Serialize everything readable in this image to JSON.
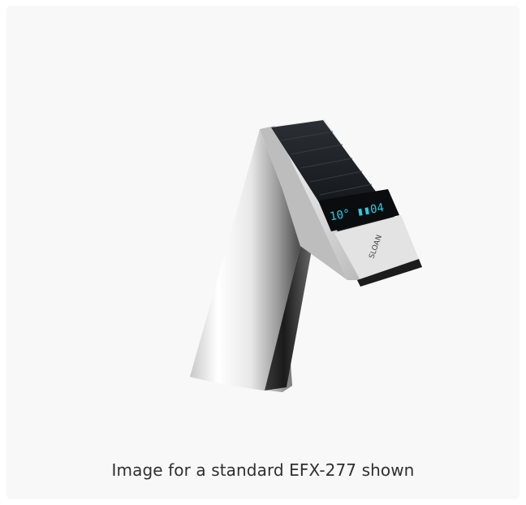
{
  "product": {
    "image_alt": "Sloan EFX-277 sensor faucet with solar panel and digital display",
    "brand_mark": "SLOAN",
    "display_readout": "10° 04",
    "caption": "Image for a standard EFX-277 shown"
  },
  "colors": {
    "background": "#f8f8f8",
    "display_glow": "#21d0e6",
    "caption_text": "#2f2f2f"
  }
}
